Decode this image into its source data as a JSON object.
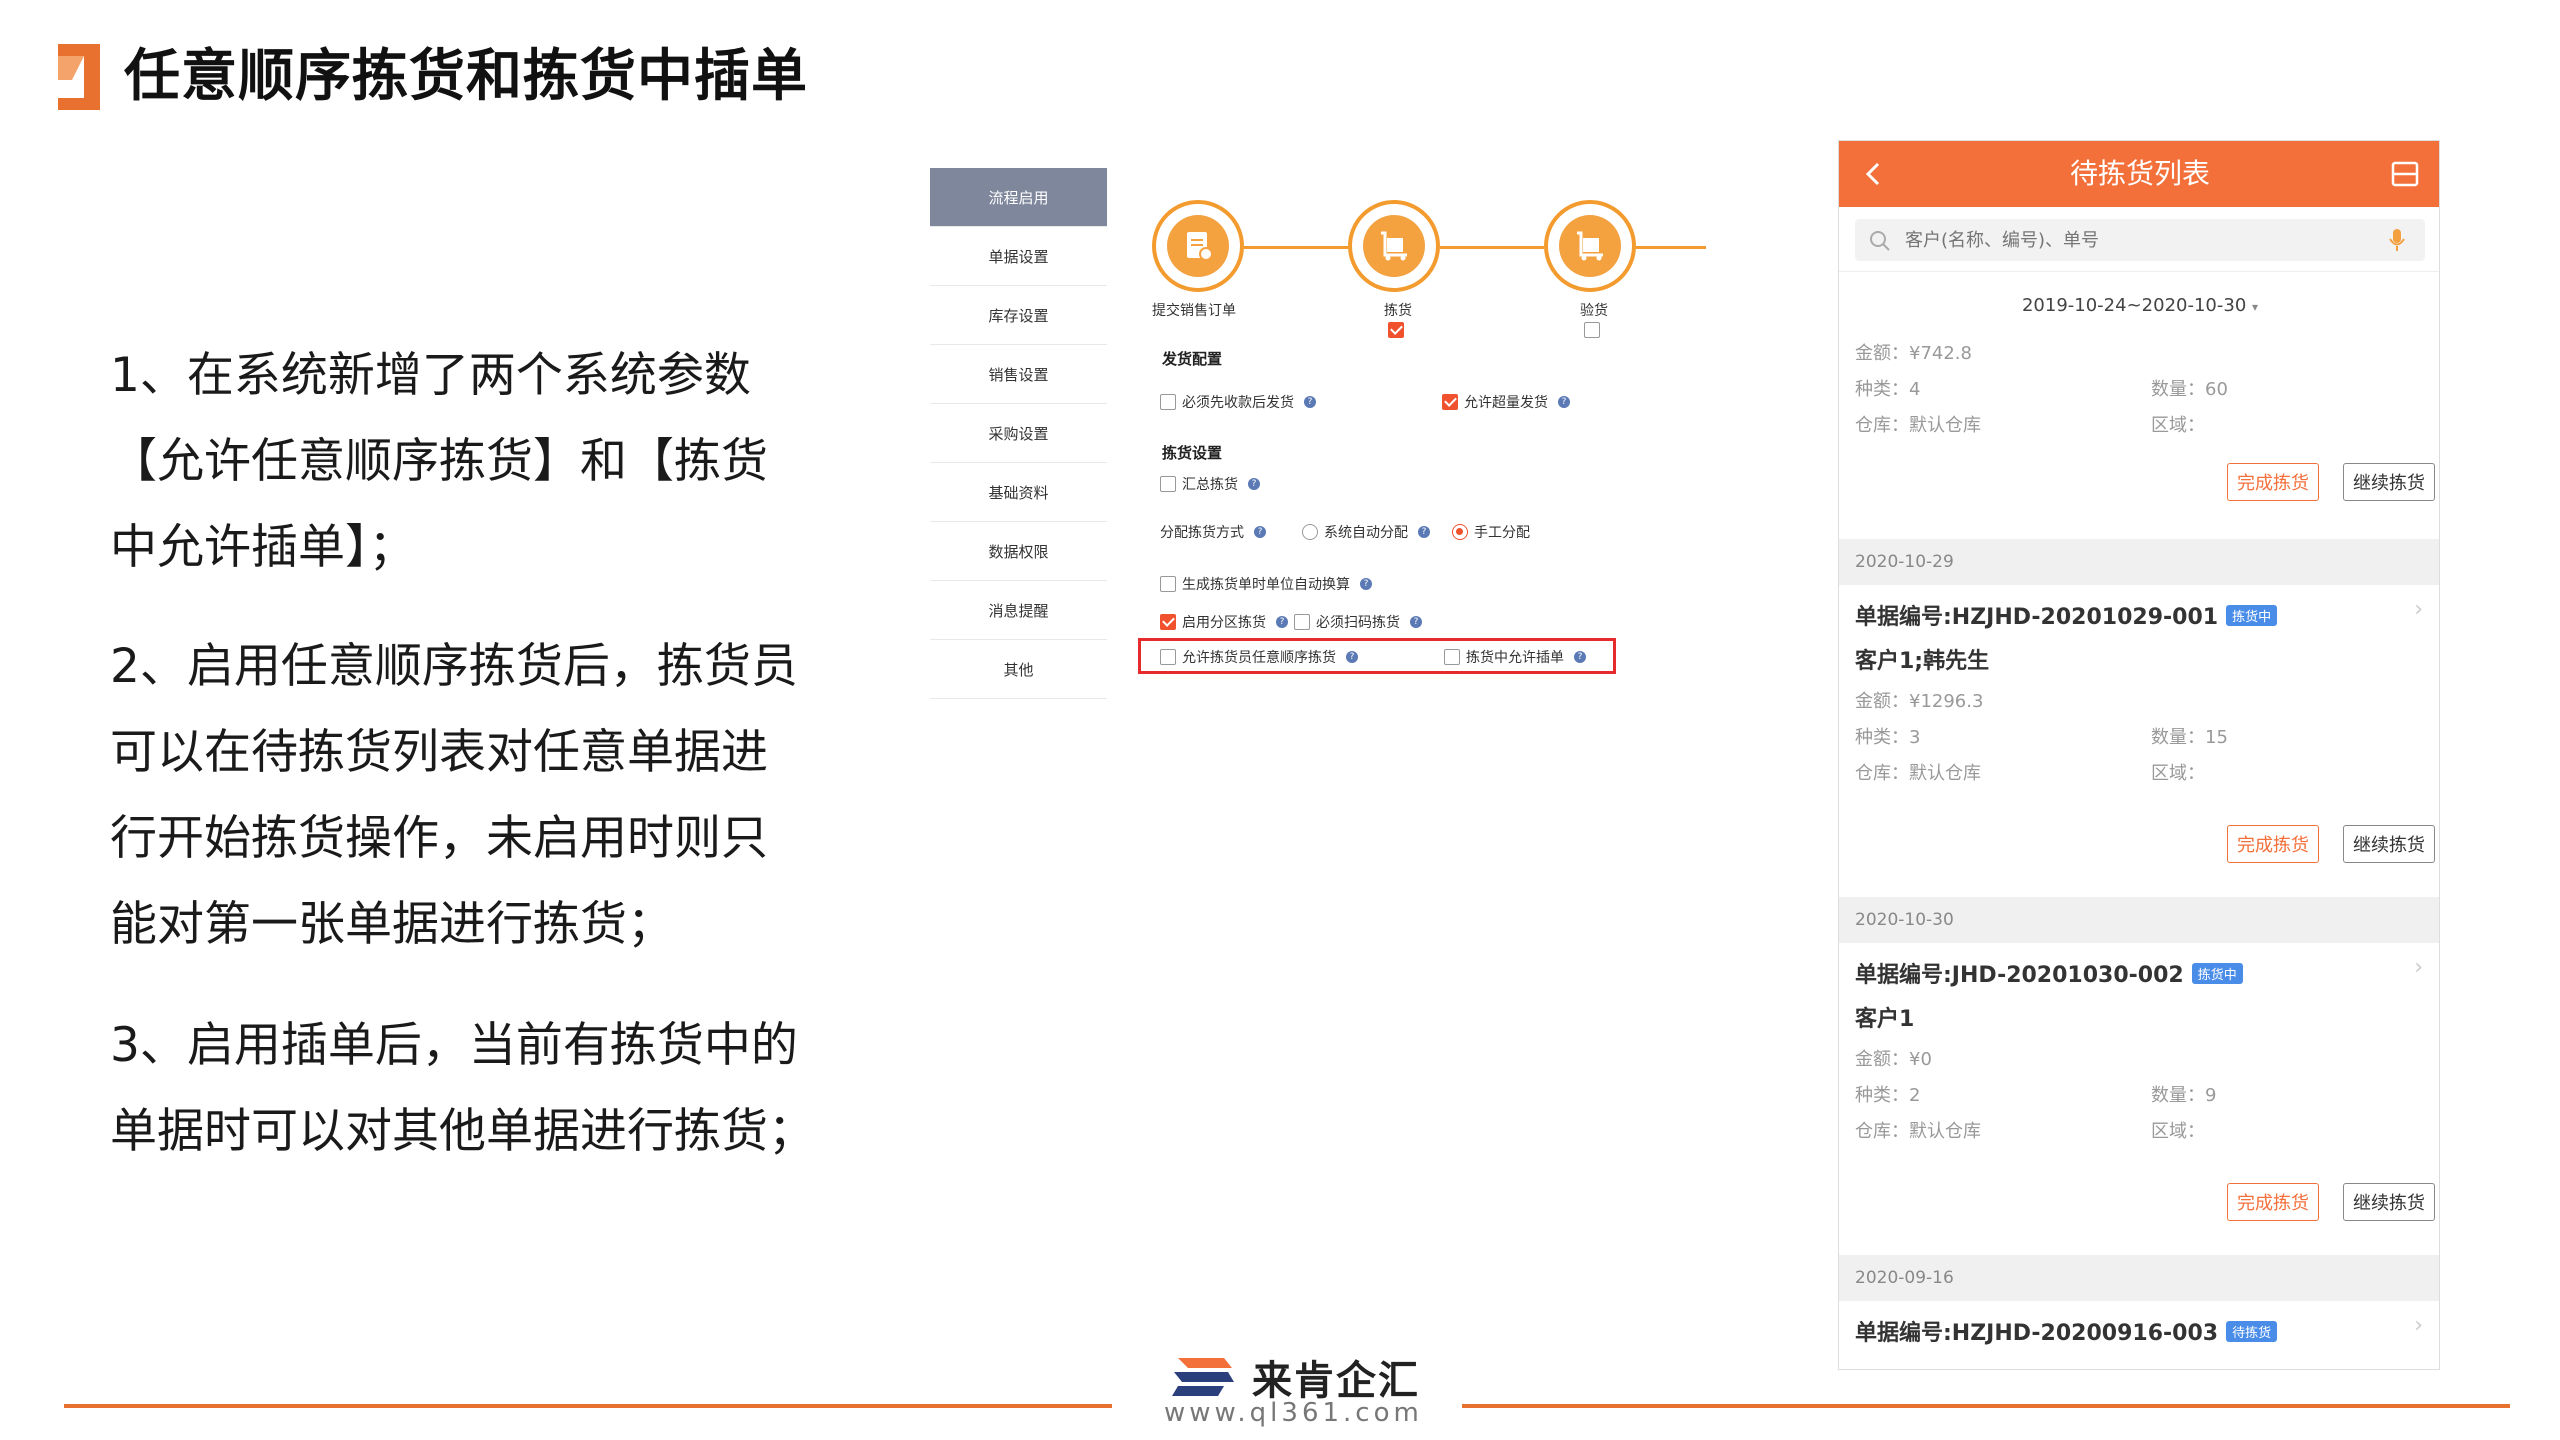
{
  "page": {
    "title": "任意顺序拣货和拣货中插单",
    "paragraphs": [
      [
        "1、在系统新增了两个系统参数",
        "【允许任意顺序拣货】和【拣货",
        "中允许插单】；"
      ],
      [
        "2、启用任意顺序拣货后，拣货员",
        "可以在待拣货列表对任意单据进",
        "行开始拣货操作，未启用时则只",
        "能对第一张单据进行拣货；"
      ],
      [
        "3、启用插单后，当前有拣货中的",
        "单据时可以对其他单据进行拣货；"
      ]
    ]
  },
  "settings": {
    "nav": [
      "流程启用",
      "单据设置",
      "库存设置",
      "销售设置",
      "采购设置",
      "基础资料",
      "数据权限",
      "消息提醒",
      "其他"
    ],
    "active_nav": "流程启用",
    "flow": [
      {
        "label": "提交销售订单",
        "checked": null
      },
      {
        "label": "拣货",
        "checked": true
      },
      {
        "label": "验货",
        "checked": false
      }
    ],
    "ship_section": "发货配置",
    "ship_opt1": "必须先收款后发货",
    "ship_opt2": "允许超量发货",
    "pick_section": "拣货设置",
    "pick_summary": "汇总拣货",
    "alloc_label": "分配拣货方式",
    "alloc_auto": "系统自动分配",
    "alloc_manual": "手工分配",
    "unit_convert": "生成拣货单时单位自动换算",
    "zone_pick": "启用分区拣货",
    "must_scan": "必须扫码拣货",
    "any_order": "允许拣货员任意顺序拣货",
    "allow_insert": "拣货中允许插单",
    "help": "?"
  },
  "phone": {
    "title": "待拣货列表",
    "search_placeholder": "客户(名称、编号)、单号",
    "date_range": "2019-10-24~2020-10-30",
    "date_arrow": "▾",
    "chevron": "›",
    "first": {
      "amount": "金额：¥742.8",
      "kinds": "种类：4",
      "qty": "数量：60",
      "warehouse": "仓库：默认仓库",
      "zone": "区域："
    },
    "groups": [
      {
        "date": "2020-10-29",
        "no": "单据编号:HZJHD-20201029-001",
        "badge": "拣货中",
        "customer": "客户1;韩先生",
        "amount": "金额：¥1296.3",
        "kinds": "种类：3",
        "qty": "数量：15",
        "warehouse": "仓库：默认仓库",
        "zone": "区域："
      },
      {
        "date": "2020-10-30",
        "no": "单据编号:JHD-20201030-002",
        "badge": "拣货中",
        "customer": "客户1",
        "amount": "金额：¥0",
        "kinds": "种类：2",
        "qty": "数量：9",
        "warehouse": "仓库：默认仓库",
        "zone": "区域："
      }
    ],
    "last": {
      "date": "2020-09-16",
      "no": "单据编号:HZJHD-20200916-003",
      "badge": "待拣货"
    },
    "btn_done": "完成拣货",
    "btn_continue": "继续拣货"
  },
  "footer": {
    "brand": "来肯企汇",
    "url": "www.ql361.com"
  },
  "colors": {
    "accent": "#f3703b",
    "flow": "#f39b2e",
    "highlight": "#e52b2b",
    "badge": "#4a8de8"
  }
}
